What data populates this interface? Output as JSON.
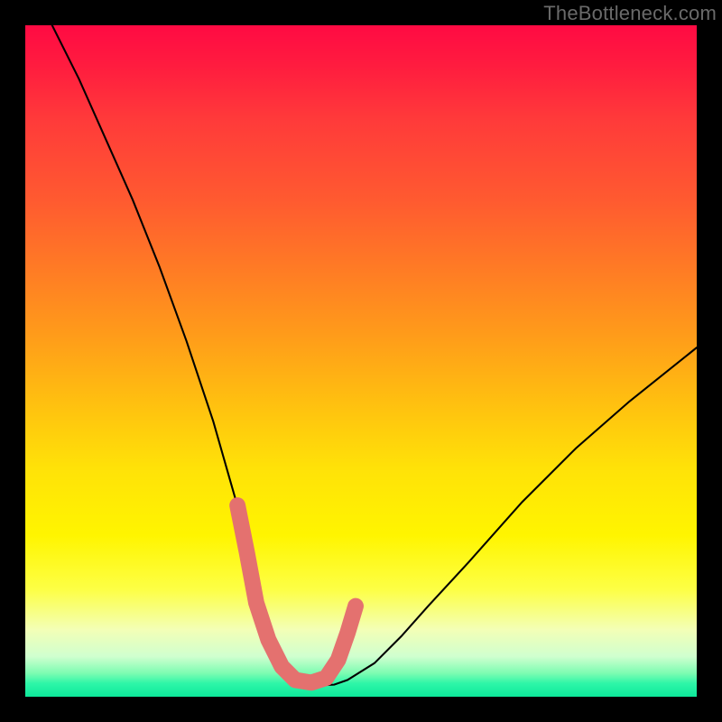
{
  "watermark": "TheBottleneck.com",
  "chart_data": {
    "type": "line",
    "title": "",
    "xlabel": "",
    "ylabel": "",
    "xlim": [
      0,
      100
    ],
    "ylim": [
      0,
      100
    ],
    "grid": false,
    "legend": false,
    "series": [
      {
        "name": "curve",
        "x": [
          4,
          8,
          12,
          16,
          20,
          24,
          28,
          30,
          32,
          33.5,
          35,
          36.5,
          38,
          39.5,
          41,
          42.5,
          44,
          46,
          48,
          52,
          56,
          60,
          66,
          74,
          82,
          90,
          100
        ],
        "values": [
          100,
          92,
          83,
          74,
          64,
          53,
          41,
          34,
          27,
          21,
          15,
          10,
          6,
          3.5,
          2.2,
          1.8,
          1.7,
          1.8,
          2.5,
          5,
          9,
          13.5,
          20,
          29,
          37,
          44,
          52
        ]
      }
    ],
    "annotations": {
      "marker_color": "#e4716f",
      "marker_points_x": [
        31.6,
        33.0,
        34.4,
        36.2,
        38.2,
        40.2,
        42.6,
        44.8,
        46.6,
        48.0,
        49.2
      ],
      "marker_points_y": [
        28.5,
        21.5,
        14.0,
        8.5,
        4.5,
        2.5,
        2.1,
        2.8,
        5.5,
        9.5,
        13.5
      ]
    }
  }
}
